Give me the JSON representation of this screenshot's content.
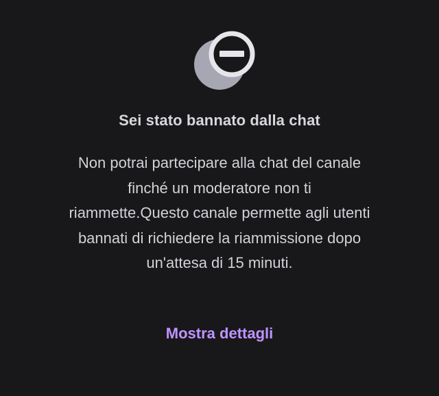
{
  "ban_notice": {
    "icon": "ban-circle-icon",
    "title": "Sei stato bannato dalla chat",
    "message": "Non potrai partecipare alla chat del canale finché un moderatore non ti riammette.Questo canale permette agli utenti bannati di richiedere la riammissione dopo un'attesa di 15 minuti.",
    "details_link": "Mostra dettagli"
  },
  "colors": {
    "background": "#18181b",
    "text": "#d2d2d7",
    "accent": "#bf94ff",
    "icon_back": "#a7a7b4",
    "icon_front": "#e6e6ea"
  }
}
